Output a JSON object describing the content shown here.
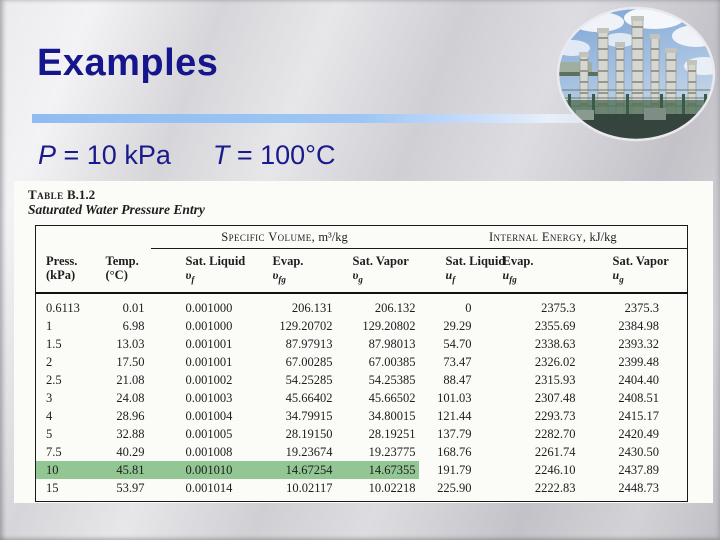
{
  "slide": {
    "title": "Examples",
    "condition": {
      "p_symbol": "P",
      "p_rest": " = 10 kPa",
      "t_symbol": "T",
      "t_rest": " = 100°C"
    },
    "colors": {
      "title_navy": "#15158c",
      "divider_blue": "#9dc6f5",
      "highlight_green": "#92c794"
    }
  },
  "plant_image": {
    "name": "industrial-plant-photo",
    "description": "oval photo of distillation columns against cloudy sky"
  },
  "table_image": {
    "caption_line1_smallcaps": "Table",
    "caption_line1_rest": " B.1.2",
    "caption_line2": "Saturated Water Pressure Entry",
    "groups": [
      {
        "label": "Specific Volume,",
        "unit": "m³/kg"
      },
      {
        "label": "Internal Energy,",
        "unit": "kJ/kg"
      }
    ],
    "columns": [
      {
        "line1": "Press.",
        "line2": "(kPa)"
      },
      {
        "line1": "Temp.",
        "line2": "(°C)"
      },
      {
        "line1": "Sat. Liquid",
        "sym": "υ",
        "sub": "f"
      },
      {
        "line1": "Evap.",
        "sym": "υ",
        "sub": "fg"
      },
      {
        "line1": "Sat. Vapor",
        "sym": "υ",
        "sub": "g"
      },
      {
        "line1": "Sat. Liquid",
        "sym": "u",
        "sub": "f"
      },
      {
        "line1": "Evap.",
        "sym": "u",
        "sub": "fg"
      },
      {
        "line1": "Sat. Vapor",
        "sym": "u",
        "sub": "g"
      }
    ],
    "rows": [
      [
        "0.6113",
        "0.01",
        "0.001000",
        "206.131",
        "206.132",
        "0",
        "2375.3",
        "2375.3"
      ],
      [
        "1",
        "6.98",
        "0.001000",
        "129.20702",
        "129.20802",
        "29.29",
        "2355.69",
        "2384.98"
      ],
      [
        "1.5",
        "13.03",
        "0.001001",
        "87.97913",
        "87.98013",
        "54.70",
        "2338.63",
        "2393.32"
      ],
      [
        "2",
        "17.50",
        "0.001001",
        "67.00285",
        "67.00385",
        "73.47",
        "2326.02",
        "2399.48"
      ],
      [
        "2.5",
        "21.08",
        "0.001002",
        "54.25285",
        "54.25385",
        "88.47",
        "2315.93",
        "2404.40"
      ],
      [
        "3",
        "24.08",
        "0.001003",
        "45.66402",
        "45.66502",
        "101.03",
        "2307.48",
        "2408.51"
      ],
      [
        "4",
        "28.96",
        "0.001004",
        "34.79915",
        "34.80015",
        "121.44",
        "2293.73",
        "2415.17"
      ],
      [
        "5",
        "32.88",
        "0.001005",
        "28.19150",
        "28.19251",
        "137.79",
        "2282.70",
        "2420.49"
      ],
      [
        "7.5",
        "40.29",
        "0.001008",
        "19.23674",
        "19.23775",
        "168.76",
        "2261.74",
        "2430.50"
      ],
      [
        "10",
        "45.81",
        "0.001010",
        "14.67254",
        "14.67355",
        "191.79",
        "2246.10",
        "2437.89"
      ],
      [
        "15",
        "53.97",
        "0.001014",
        "10.02117",
        "10.02218",
        "225.90",
        "2222.83",
        "2448.73"
      ]
    ],
    "highlighted_row_index": 9,
    "highlight_column_count": 5,
    "highlight_color": "#92c794"
  }
}
